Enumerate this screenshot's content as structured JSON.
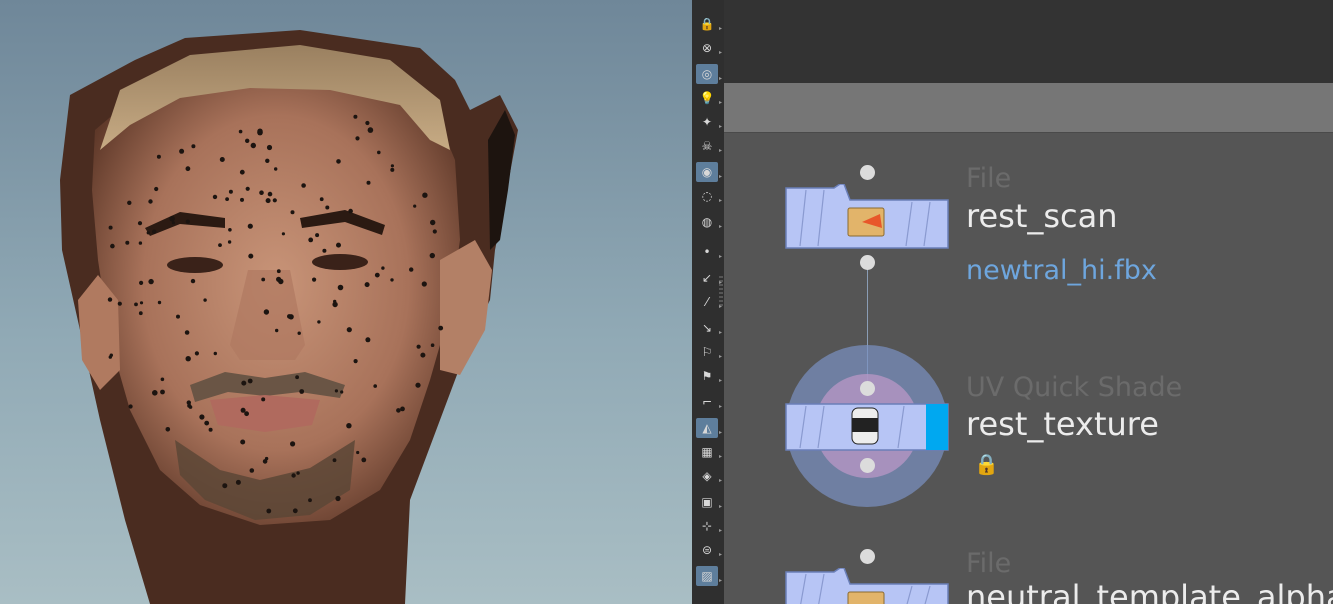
{
  "viewport": {
    "background_top": "#6f8799",
    "background_bottom": "#a9bec4",
    "marker_color": "#1c1410"
  },
  "toolbar": {
    "tools": [
      {
        "name": "lock-icon",
        "glyph": "🔒",
        "active": false
      },
      {
        "name": "close-circle-icon",
        "glyph": "⊗",
        "active": false
      },
      {
        "name": "ghost-icon",
        "glyph": "◎",
        "active": true
      },
      {
        "name": "light-icon",
        "glyph": "💡",
        "active": false
      },
      {
        "name": "light-add-icon",
        "glyph": "✦",
        "active": false
      },
      {
        "name": "skull-icon",
        "glyph": "☠",
        "active": false
      },
      {
        "name": "camera-icon",
        "glyph": "◉",
        "active": true
      },
      {
        "name": "eye-icon",
        "glyph": "◌",
        "active": false
      },
      {
        "name": "display-icon",
        "glyph": "◍",
        "active": false
      },
      {
        "name": "point-icon",
        "glyph": "•",
        "active": false
      },
      {
        "name": "arrow-icon",
        "glyph": "↙",
        "active": false
      },
      {
        "name": "pin-icon",
        "glyph": "⁄",
        "active": false
      },
      {
        "name": "point-number-icon",
        "glyph": "↘",
        "active": false
      },
      {
        "name": "brush-icon",
        "glyph": "⚐",
        "active": false
      },
      {
        "name": "prim-number-icon",
        "glyph": "⚑",
        "active": false
      },
      {
        "name": "corner-icon",
        "glyph": "⌐",
        "active": false
      },
      {
        "name": "wireframe-icon",
        "glyph": "◭",
        "active": true
      },
      {
        "name": "checker-icon",
        "glyph": "▦",
        "active": false
      },
      {
        "name": "shaded-icon",
        "glyph": "◈",
        "active": false
      },
      {
        "name": "uv-icon",
        "glyph": "▣",
        "active": false
      },
      {
        "name": "axis-icon",
        "glyph": "⊹",
        "active": false
      },
      {
        "name": "circle-icon",
        "glyph": "⊜",
        "active": false
      },
      {
        "name": "background-image-icon",
        "glyph": "▨",
        "active": true
      }
    ]
  },
  "network": {
    "nodes": [
      {
        "type": "File",
        "name": "rest_scan",
        "param": "newtral_hi.fbx",
        "icon": "folder-icon"
      },
      {
        "type": "UV Quick Shade",
        "name": "rest_texture",
        "icon": "paint-can-icon"
      },
      {
        "type": "File",
        "name": "neutral_template_alpha",
        "icon": "folder-icon"
      }
    ],
    "node_color": "#b7c5f5",
    "display_flag_color": "#00a8f0",
    "highlight_color": "#7b92c3"
  }
}
